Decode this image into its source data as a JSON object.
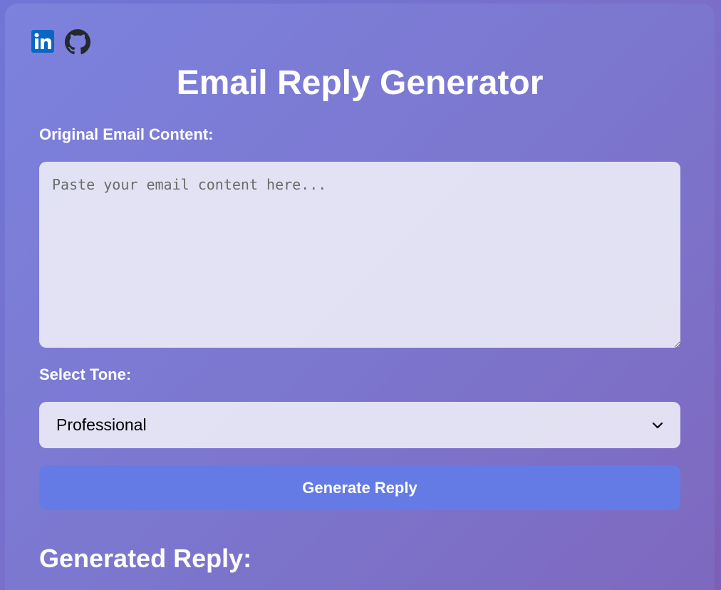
{
  "social": {
    "links": [
      {
        "icon": "linkedin-icon",
        "color": "#0a66c2"
      },
      {
        "icon": "github-icon",
        "color": "#24292e"
      }
    ]
  },
  "header": {
    "title": "Email Reply Generator"
  },
  "form": {
    "email_label": "Original Email Content:",
    "email_placeholder": "Paste your email content here...",
    "email_value": "",
    "tone_label": "Select Tone:",
    "tone_selected": "Professional",
    "generate_label": "Generate Reply"
  },
  "result": {
    "title": "Generated Reply:"
  },
  "colors": {
    "background_start": "#6f76d6",
    "background_end": "#7c5fb6",
    "button": "#647be6",
    "text": "#ffffff"
  }
}
